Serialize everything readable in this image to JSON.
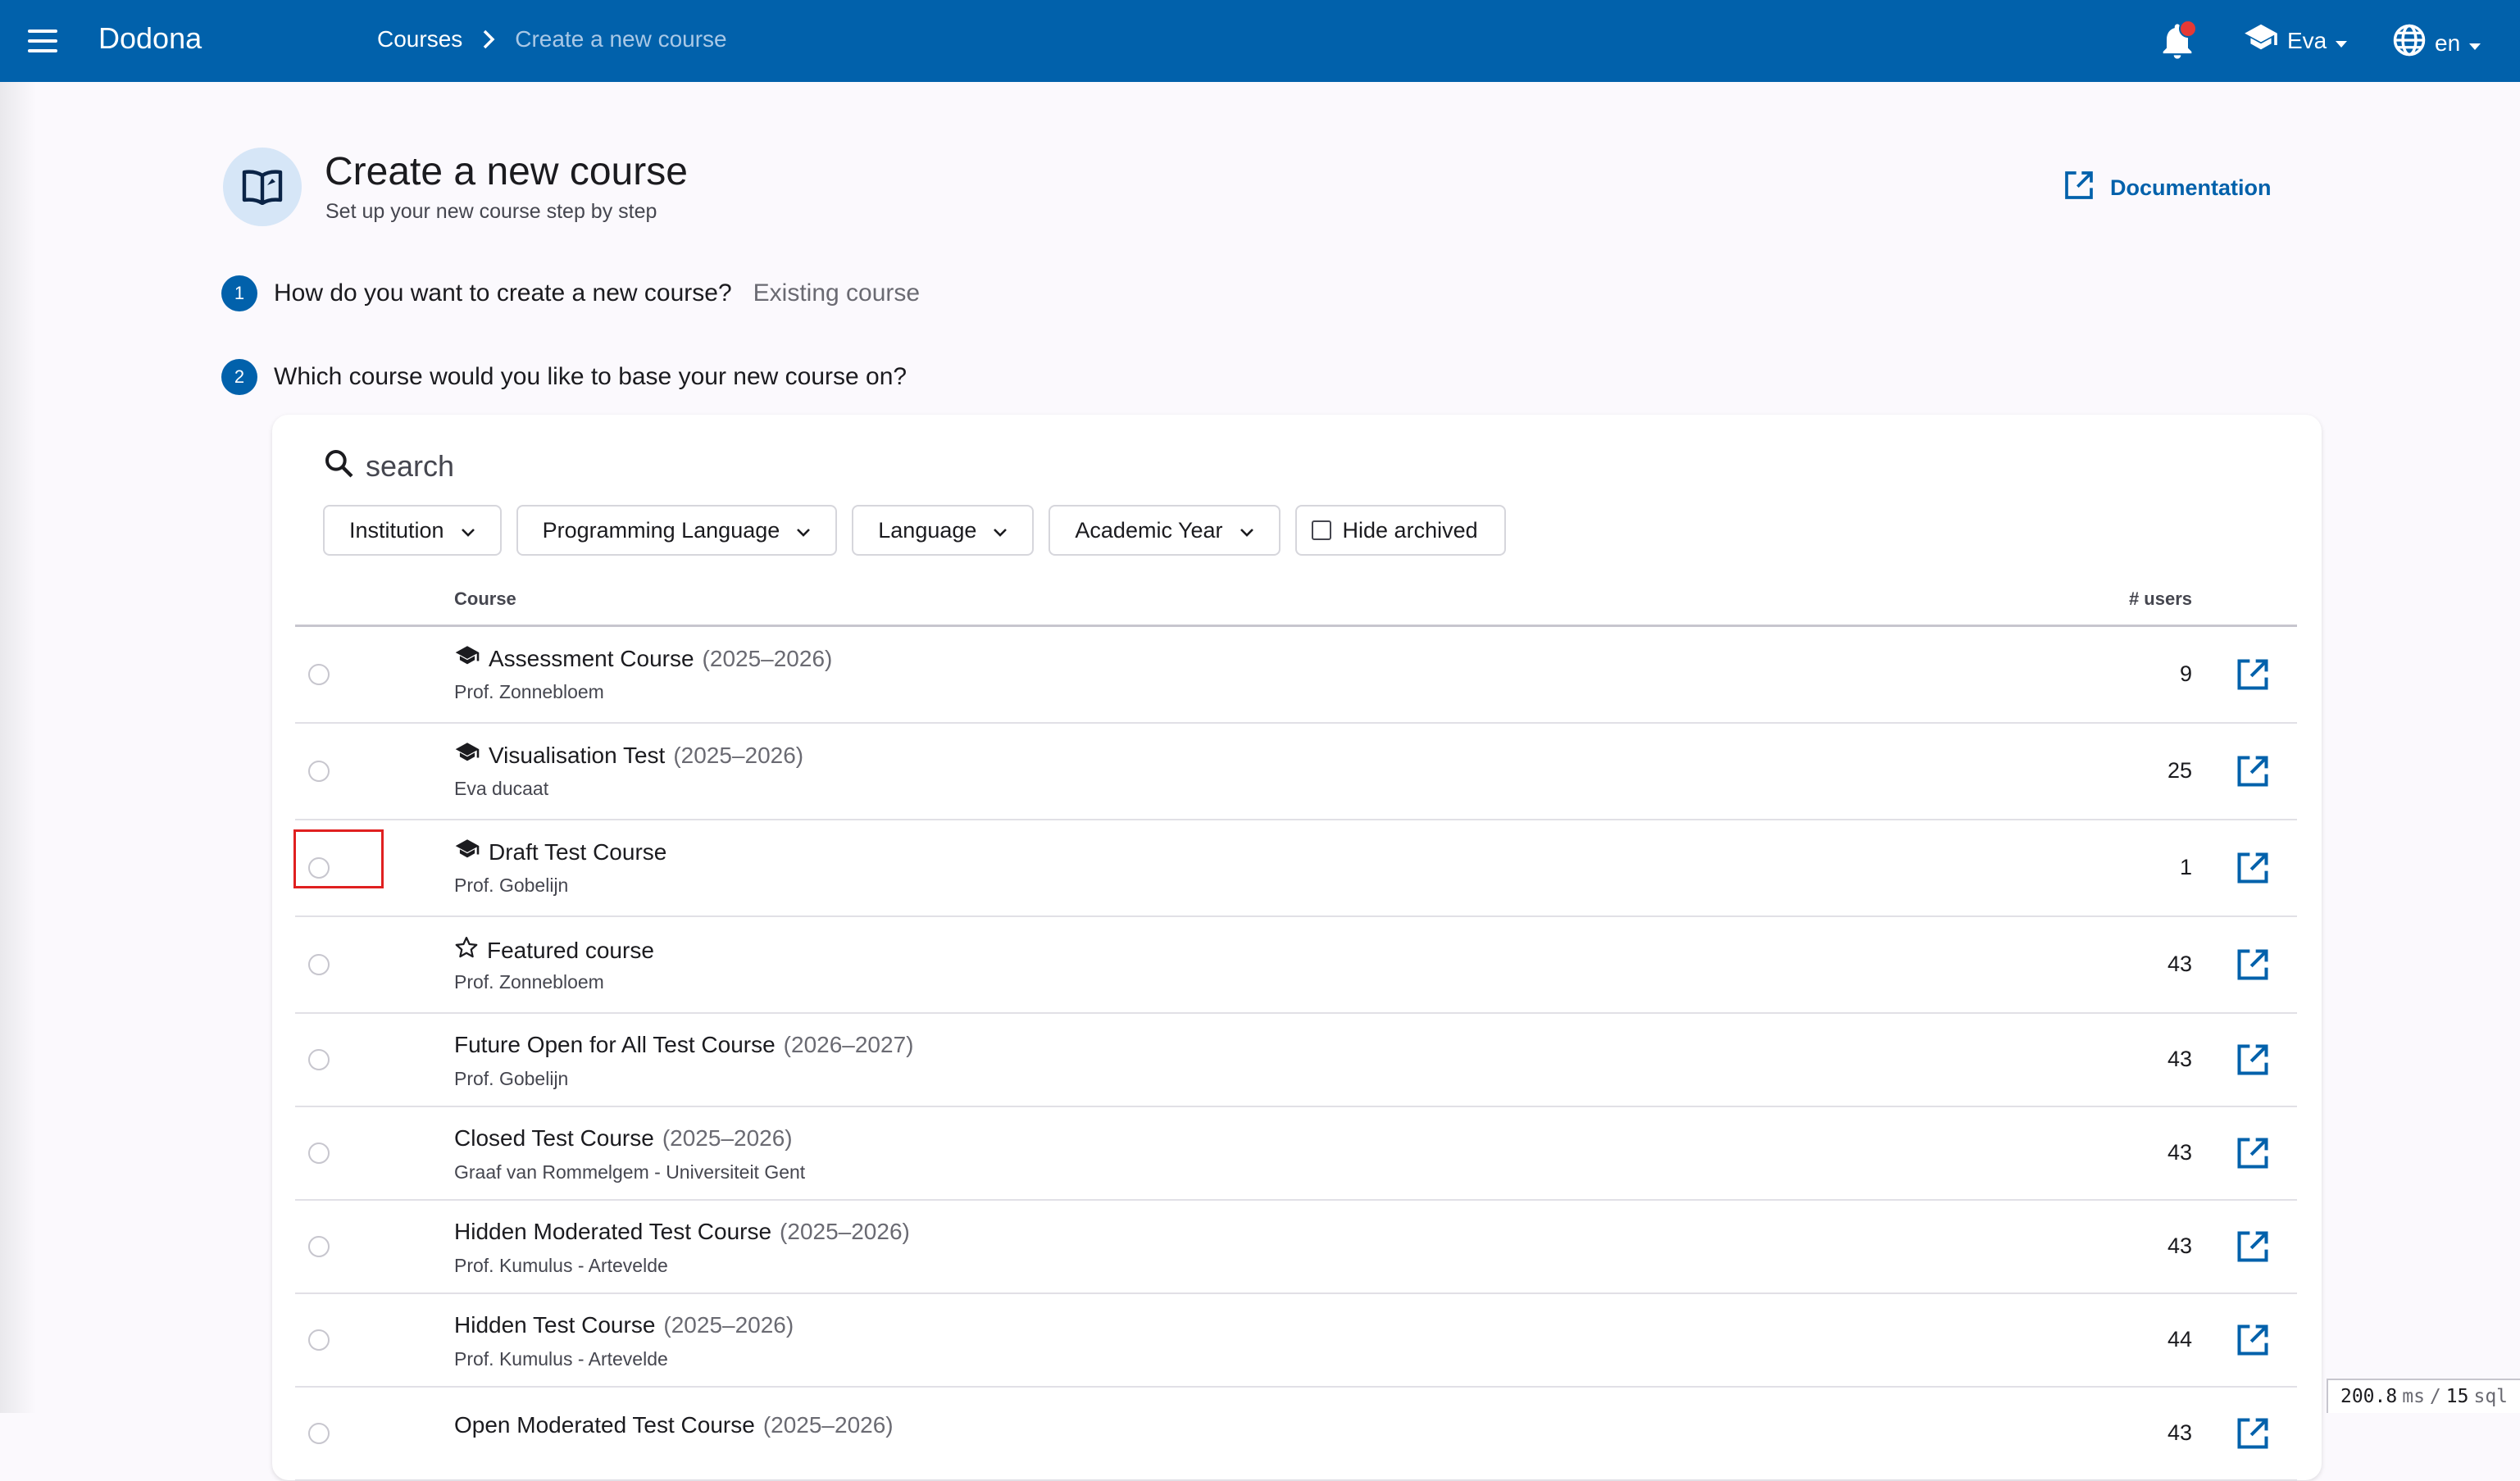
{
  "header": {
    "brand": "Dodona",
    "breadcrumb": {
      "parent": "Courses",
      "current": "Create a new course"
    },
    "user": "Eva",
    "language": "en",
    "notification_unread": true
  },
  "page": {
    "title": "Create a new course",
    "subtitle": "Set up your new course step by step",
    "documentation_label": "Documentation"
  },
  "steps": [
    {
      "number": "1",
      "question": "How do you want to create a new course?",
      "answer": "Existing course"
    },
    {
      "number": "2",
      "question": "Which course would you like to base your new course on?",
      "answer": ""
    }
  ],
  "search": {
    "placeholder": "search"
  },
  "filters": {
    "institution": "Institution",
    "programming_language": "Programming Language",
    "language": "Language",
    "academic_year": "Academic Year",
    "hide_archived": "Hide archived"
  },
  "table": {
    "headers": {
      "course": "Course",
      "users": "# users"
    },
    "rows": [
      {
        "icon": "graduation-cap-icon",
        "name": "Assessment Course",
        "year": "(2025–2026)",
        "teacher": "Prof. Zonnebloem",
        "users": "9"
      },
      {
        "icon": "graduation-cap-icon",
        "name": "Visualisation Test",
        "year": "(2025–2026)",
        "teacher": "Eva ducaat",
        "users": "25"
      },
      {
        "icon": "graduation-cap-icon",
        "name": "Draft Test Course",
        "year": "",
        "teacher": "Prof. Gobelijn",
        "users": "1"
      },
      {
        "icon": "star-outline-icon",
        "name": "Featured course",
        "year": "",
        "teacher": "Prof. Zonnebloem",
        "users": "43"
      },
      {
        "icon": "",
        "name": "Future Open for All Test Course",
        "year": "(2026–2027)",
        "teacher": "Prof. Gobelijn",
        "users": "43"
      },
      {
        "icon": "",
        "name": "Closed Test Course",
        "year": "(2025–2026)",
        "teacher": "Graaf van Rommelgem - Universiteit Gent",
        "users": "43"
      },
      {
        "icon": "",
        "name": "Hidden Moderated Test Course",
        "year": "(2025–2026)",
        "teacher": "Prof. Kumulus - Artevelde",
        "users": "43"
      },
      {
        "icon": "",
        "name": "Hidden Test Course",
        "year": "(2025–2026)",
        "teacher": "Prof. Kumulus - Artevelde",
        "users": "44"
      },
      {
        "icon": "",
        "name": "Open Moderated Test Course",
        "year": "(2025–2026)",
        "teacher": "",
        "users": "43"
      }
    ]
  },
  "perf": {
    "time": "200.8",
    "time_unit": "ms",
    "sep": "/",
    "queries": "15",
    "queries_unit": "sql"
  },
  "colors": {
    "primary": "#0161ab",
    "background": "#fbf9fd",
    "highlight": "#e02020"
  }
}
